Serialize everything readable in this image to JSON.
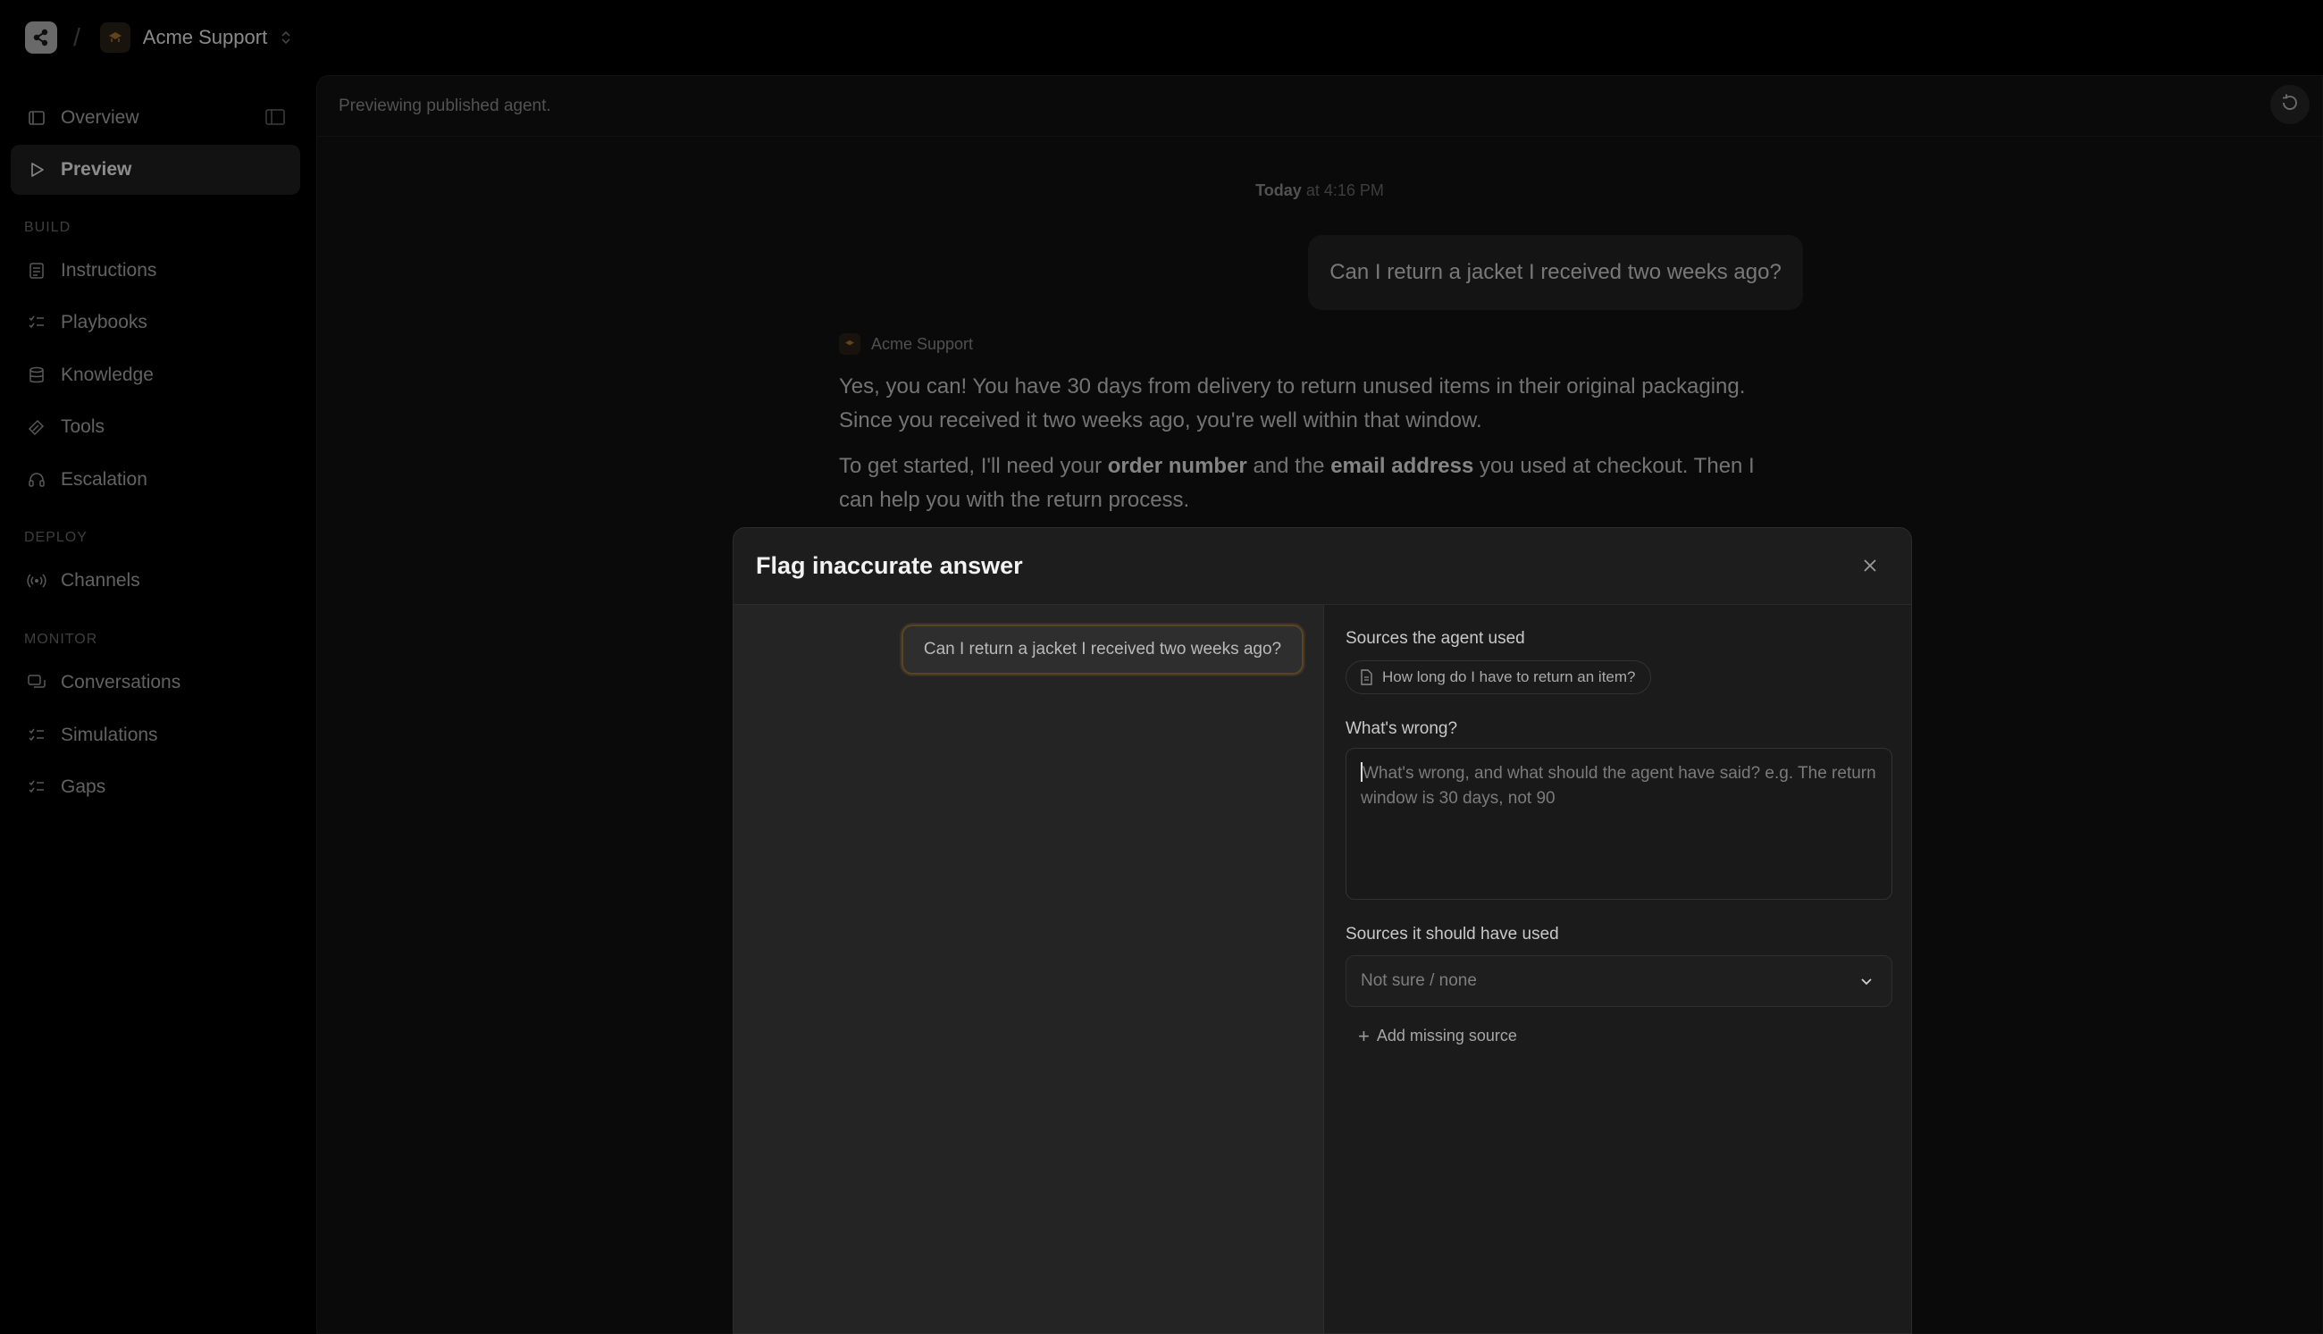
{
  "topbar": {
    "workspace_name": "Acme Support",
    "separator": "/"
  },
  "sidebar": {
    "items": [
      {
        "label": "Overview",
        "icon": "overview-icon"
      },
      {
        "label": "Preview",
        "icon": "play-icon",
        "active": true
      }
    ],
    "sections": [
      {
        "title": "BUILD",
        "items": [
          {
            "label": "Instructions",
            "icon": "instructions-icon"
          },
          {
            "label": "Playbooks",
            "icon": "playbooks-icon"
          },
          {
            "label": "Knowledge",
            "icon": "database-icon"
          },
          {
            "label": "Tools",
            "icon": "tools-icon"
          },
          {
            "label": "Escalation",
            "icon": "headset-icon"
          }
        ]
      },
      {
        "title": "DEPLOY",
        "items": [
          {
            "label": "Channels",
            "icon": "broadcast-icon"
          }
        ]
      },
      {
        "title": "MONITOR",
        "items": [
          {
            "label": "Conversations",
            "icon": "chat-icon"
          },
          {
            "label": "Simulations",
            "icon": "list-check-icon"
          },
          {
            "label": "Gaps",
            "icon": "list-check-icon"
          }
        ]
      }
    ]
  },
  "main": {
    "preview_note": "Previewing published agent.",
    "timestamp_day": "Today",
    "timestamp_time": "at 4:16 PM",
    "user_message": "Can I return a jacket I received two weeks ago?",
    "agent_name": "Acme Support",
    "agent_p1": "Yes, you can! You have 30 days from delivery to return unused items in their original packaging. Since you received it two weeks ago, you're well within that window.",
    "agent_p2_a": "To get started, I'll need your ",
    "agent_p2_b": "order number",
    "agent_p2_c": " and the ",
    "agent_p2_d": "email address",
    "agent_p2_e": " you used at checkout. Then I can help you with the return process."
  },
  "modal": {
    "title": "Flag inaccurate answer",
    "quoted_question": "Can I return a jacket I received two weeks ago?",
    "sources_used_label": "Sources the agent used",
    "source_chip": "How long do I have to return an item?",
    "whats_wrong_label": "What's wrong?",
    "whats_wrong_placeholder": "What's wrong, and what should the agent have said? e.g. The return window is 30 days, not 90",
    "should_have_used_label": "Sources it should have used",
    "select_value": "Not sure / none",
    "add_source_label": "Add missing source"
  }
}
